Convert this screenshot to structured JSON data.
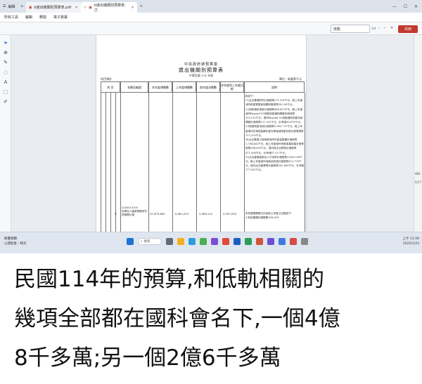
{
  "browser": {
    "tabs": [
      {
        "label": "編輯",
        "active": false
      },
      {
        "label": "b歲出機關別預算表.pdf",
        "active": false
      },
      {
        "label": "b歲出機關別預算表.己",
        "active": true
      }
    ],
    "new_tab": "+",
    "menu": [
      "所有工具",
      "編輯",
      "轉換",
      "電子簽署"
    ],
    "search_value": "低軌",
    "match_count": "1/4",
    "share_label": "共用"
  },
  "document": {
    "title_line1": "中央政府總預算案",
    "title_line2": "歲出機關別預算表",
    "title_line3": "中華民國 114 年度",
    "left_label": "科目預計",
    "right_label": "單位：新臺幣千元",
    "headers": [
      "科",
      "目",
      "名稱及編號",
      "本年度預算數",
      "上年度預算數",
      "前年度決算數",
      "本年度與上年度比較",
      "說明"
    ],
    "row_index": "4",
    "row_code": "5265013100\n科學及人國家實驗研究院發展計畫",
    "row_values": [
      "12,479,885",
      "6,882,675",
      "3,988,221",
      "5,597,610"
    ],
    "notes_text": "較如下：\n(1)太空基礎研究計畫經費271,931千元，較上年度減列衛星實驗室相關研發經費38,328千元。\n(2)低軌通訊衛星計畫經費488,413千元，較上年度減列Beyond 5G低軌衛星通訊酬載系統經費100,312千元，增列Beyond 5G低軌通訊衛星系統開發計畫經費137,033千元，計淨增36,678千元。\n(3)衛星衛星系統計畫經費1,655,731千元，較上年度增列先導型高解析度光學遙感衛星系統計畫等經費757,293千元。\n(4)太空基礎工程與應用研究能量整備計畫經費1,394,462千元，較上年度減列低軌衛星衛星計畫等經費384,693千元，增列其太空經費計畫經費471,566千元，計淨減87,127千元。\n(5)太空產業創新及人才培育計畫經費1,456,538千元，較上年度減列地面站設施計畫經費552,776千元，增列太空產業等計畫經費282,669千元，計淨增177,091千元。",
    "notes_tail": "本年度預算數已內含除上年度之比較如下：\n1.科技發展計畫經費108,318"
  },
  "sidebar_right": {
    "page_num": "482",
    "page_of": "5/17"
  },
  "taskbar": {
    "weather_temp": "軟體預顯",
    "weather_desc": "公開氣象｜晴天",
    "search_placeholder": "搜尋",
    "time": "上午 11:59",
    "date": "2025/1/23"
  },
  "caption_lines": [
    "民國114年的預算,和低軌相關的",
    "幾項全部都在國科會名下,一個4億",
    "8千多萬;另一個2億6千多萬"
  ]
}
